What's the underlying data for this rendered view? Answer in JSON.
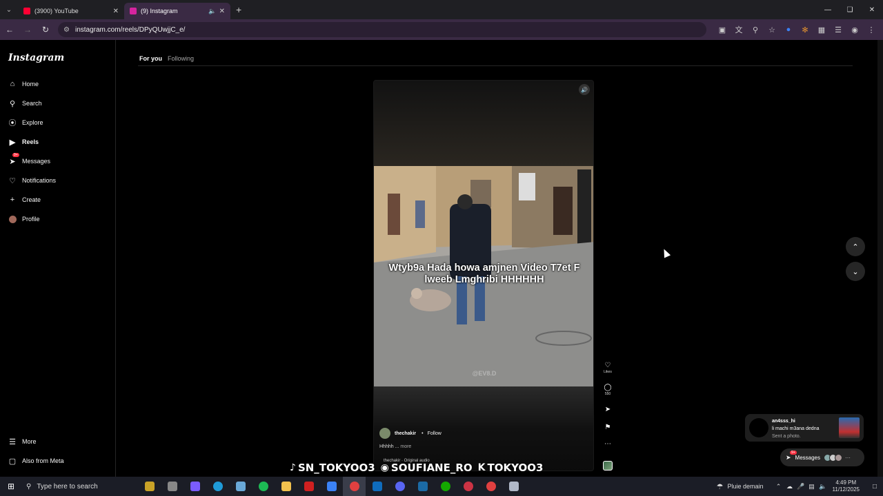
{
  "browser": {
    "tabs": [
      {
        "title": "(3900) YouTube",
        "favicon_color": "#ff0033",
        "active": false
      },
      {
        "title": "(9) Instagram",
        "favicon_color": "#d6249f",
        "active": true
      }
    ],
    "url": "instagram.com/reels/DPyQUwjjC_e/",
    "icons": [
      "install-icon",
      "translate-icon",
      "zoom-icon",
      "bookmark-star-icon",
      "extension-icon",
      "profile-icon",
      "menu-icon"
    ]
  },
  "instagram": {
    "logo": "Instagram",
    "nav": [
      {
        "label": "Home",
        "icon": "home-icon"
      },
      {
        "label": "Search",
        "icon": "search-icon"
      },
      {
        "label": "Explore",
        "icon": "explore-icon"
      },
      {
        "label": "Reels",
        "icon": "reels-icon"
      },
      {
        "label": "Messages",
        "icon": "messages-icon",
        "badge": "9+"
      },
      {
        "label": "Notifications",
        "icon": "heart-icon"
      },
      {
        "label": "Create",
        "icon": "plus-icon"
      },
      {
        "label": "Profile",
        "icon": "avatar-icon"
      }
    ],
    "nav_bottom": [
      {
        "label": "More",
        "icon": "hamburger-icon"
      },
      {
        "label": "Also from Meta",
        "icon": "meta-icon"
      }
    ],
    "feed_tabs": {
      "for_you": "For you",
      "following": "Following"
    },
    "reel": {
      "caption": "Wtyb9a Hada howa amjnen Video T7et F lweeb Lmghribi HHHHHH",
      "watermark": "@EV8.D",
      "author": "thechakir",
      "separator": "•",
      "follow": "Follow",
      "description": "Hhhhh ...",
      "more": "more",
      "audio": "thechakir · Original audio",
      "likes_label": "Likes",
      "comments_count": "550"
    },
    "overlay_handles": [
      {
        "icon": "tiktok-icon",
        "text": "SN_TOKYOO3"
      },
      {
        "icon": "instagram-icon",
        "text": "SOUFIANE_RO"
      },
      {
        "icon": "kick-icon",
        "text": "TOKYOO3"
      }
    ],
    "notification": {
      "user": "an4sss_hi",
      "message": "li machi m3ana dedna",
      "sub": "Sent a photo."
    },
    "messages_pill": {
      "label": "Messages",
      "badge": "9+"
    }
  },
  "taskbar": {
    "search_placeholder": "Type here to search",
    "weather": "Pluie demain",
    "time": "4:49 PM",
    "date": "11/12/2025",
    "apps": [
      {
        "name": "coins-app",
        "color": "#c9a227"
      },
      {
        "name": "task-view",
        "color": "#888888"
      },
      {
        "name": "copilot",
        "color": "#7b5cff"
      },
      {
        "name": "edge",
        "color": "#1f9bd8"
      },
      {
        "name": "notes",
        "color": "#6aa9d8"
      },
      {
        "name": "spotify",
        "color": "#1db954"
      },
      {
        "name": "file-explorer",
        "color": "#f2c14e"
      },
      {
        "name": "red-app",
        "color": "#d02020"
      },
      {
        "name": "store",
        "color": "#3b82f6"
      },
      {
        "name": "chrome",
        "color": "#e04040"
      },
      {
        "name": "outlook",
        "color": "#0f6cbd"
      },
      {
        "name": "discord",
        "color": "#5865f2"
      },
      {
        "name": "steam",
        "color": "#1b6aa5"
      },
      {
        "name": "upwork",
        "color": "#14a800"
      },
      {
        "name": "vpn",
        "color": "#cc3344"
      },
      {
        "name": "chrome-2",
        "color": "#e04040"
      },
      {
        "name": "tool",
        "color": "#b0b8c8"
      }
    ]
  }
}
